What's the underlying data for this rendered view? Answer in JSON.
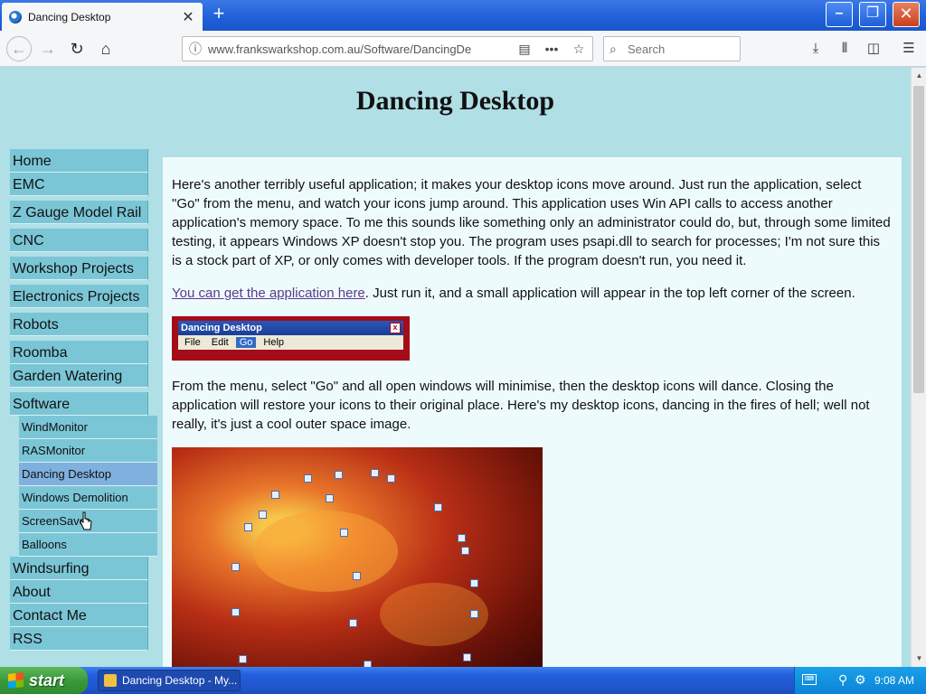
{
  "browser": {
    "tab_title": "Dancing Desktop",
    "tab_close": "✕",
    "new_tab": "+",
    "url": "www.frankswarkshop.com.au/Software/DancingDe",
    "search_placeholder": "Search"
  },
  "window": {
    "minimize": "–",
    "maximize": "❐",
    "close": "✕"
  },
  "page": {
    "title": "Dancing Desktop",
    "nav": [
      {
        "label": "Home"
      },
      {
        "label": "EMC"
      },
      {
        "label": "Z Gauge Model Rail"
      },
      {
        "label": "CNC"
      },
      {
        "label": "Workshop Projects"
      },
      {
        "label": "Electronics Projects"
      },
      {
        "label": "Robots"
      },
      {
        "label": "Roomba"
      },
      {
        "label": "Garden Watering"
      },
      {
        "label": "Software"
      }
    ],
    "software_sub": [
      {
        "label": "WindMonitor"
      },
      {
        "label": "RASMonitor"
      },
      {
        "label": "Dancing Desktop"
      },
      {
        "label": "Windows Demolition"
      },
      {
        "label": "ScreenSaver"
      },
      {
        "label": "Balloons"
      }
    ],
    "nav_after": [
      {
        "label": "Windsurfing"
      },
      {
        "label": "About"
      },
      {
        "label": "Contact Me"
      },
      {
        "label": "RSS"
      }
    ],
    "paragraph1": "Here's another terribly useful application; it makes your desktop icons move around. Just run the application, select \"Go\" from the menu, and watch your icons jump around.  This application uses Win API calls to access another application's memory space.  To me this sounds like something only an administrator could do, but, through some limited testing, it appears Windows XP doesn't stop you.  The program uses psapi.dll to search for processes; I'm not sure this is a stock part of XP, or only comes with developer tools.  If the program doesn't run, you need it.",
    "download_link": "You can get the application here",
    "download_suffix": ". Just run it, and a small application will appear in the top left corner of the screen.",
    "app_window": {
      "title": "Dancing Desktop",
      "close": "x",
      "menu": [
        "File",
        "Edit",
        "Go",
        "Help"
      ]
    },
    "paragraph2": "From the menu, select \"Go\" and all open windows will minimise, then the desktop icons will dance.  Closing the application will restore your icons to their original place.  Here's my desktop icons, dancing in the fires of hell; well not really, it's just a cool outer space image."
  },
  "taskbar": {
    "start": "start",
    "task": "Dancing Desktop - My...",
    "clock": "9:08 AM"
  },
  "icons": {
    "reload": "reload-icon",
    "home": "home-icon",
    "bookmark": "star-icon",
    "download": "download-icon"
  }
}
